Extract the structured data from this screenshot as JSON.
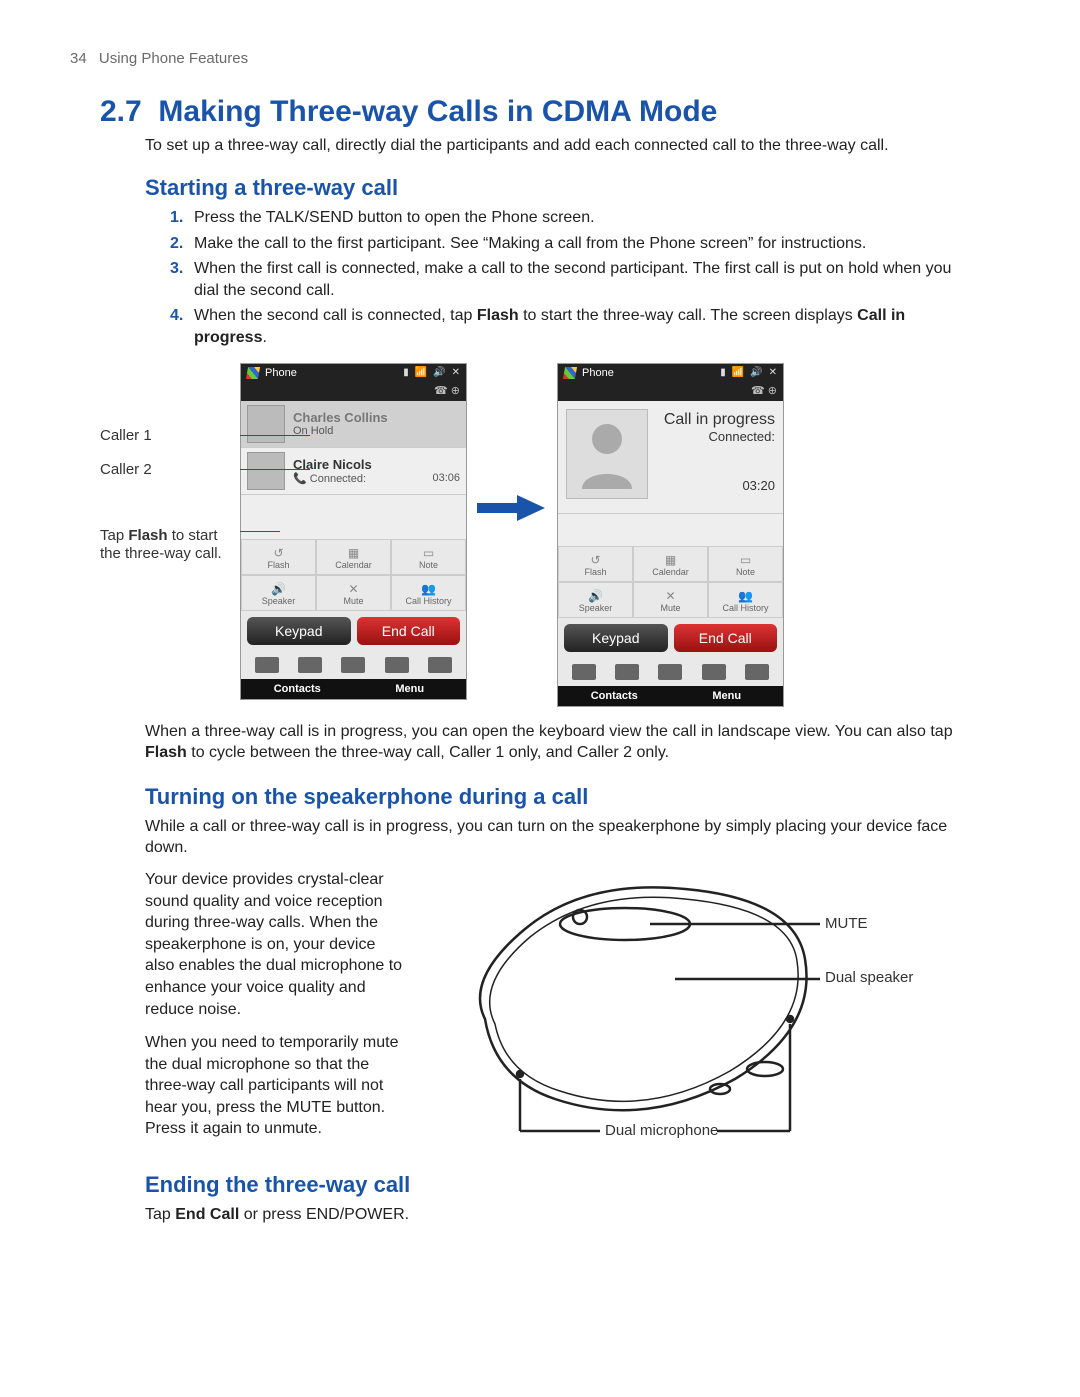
{
  "header": {
    "page_number": "34",
    "chapter": "Using Phone Features"
  },
  "section": {
    "number": "2.7",
    "title": "Making Three-way Calls in CDMA Mode",
    "intro": "To set up a three-way call, directly dial the participants and add each connected call to the three-way call."
  },
  "sub1": {
    "heading": "Starting a three-way call",
    "steps": [
      "Press the TALK/SEND button to open the Phone screen.",
      "Make the call to the first participant. See “Making a call from the Phone screen” for instructions.",
      "When the first call is connected, make a call to the second participant. The first call is put on hold when you dial the second call.",
      "When the second call is connected, tap "
    ],
    "step4_flash": "Flash",
    "step4_mid": " to start the three-way call. The screen displays ",
    "step4_cip": "Call in progress",
    "step4_end": "."
  },
  "annots": {
    "caller1": "Caller 1",
    "caller2": "Caller 2",
    "tapflash_pre": "Tap ",
    "tapflash_b": "Flash",
    "tapflash_post": " to start the three-way call."
  },
  "phoneA": {
    "title": "Phone",
    "c1_name": "Charles Collins",
    "c1_sub": "On Hold",
    "c2_name": "Claire Nicols",
    "c2_sub": "Connected:",
    "c2_time": "03:06",
    "btns": {
      "flash": "Flash",
      "calendar": "Calendar",
      "note": "Note",
      "speaker": "Speaker",
      "mute": "Mute",
      "history": "Call History"
    },
    "keypad": "Keypad",
    "endcall": "End Call",
    "foot_l": "Contacts",
    "foot_r": "Menu"
  },
  "phoneB": {
    "title": "Phone",
    "cip": "Call in progress",
    "conn": "Connected:",
    "time": "03:20",
    "btns": {
      "flash": "Flash",
      "calendar": "Calendar",
      "note": "Note",
      "speaker": "Speaker",
      "mute": "Mute",
      "history": "Call History"
    },
    "keypad": "Keypad",
    "endcall": "End Call",
    "foot_l": "Contacts",
    "foot_r": "Menu"
  },
  "after_fig": {
    "p_pre": "When a three-way call is in progress, you can open the keyboard view the call in landscape view. You can also tap ",
    "p_b": "Flash",
    "p_post": " to cycle between the three-way call, Caller 1 only, and Caller 2 only."
  },
  "sub2": {
    "heading": "Turning on the speakerphone during a call",
    "intro": "While a call or three-way call is in progress, you can turn on the speakerphone by simply placing your device face down.",
    "p2": "Your device provides crystal-clear sound quality and voice reception during three-way calls. When the speakerphone is on, your device also enables the dual microphone to enhance your voice quality and reduce noise.",
    "p3": "When you need to temporarily mute the dual microphone so that the three-way call participants will not hear you, press the MUTE button. Press it again to unmute."
  },
  "diagram_labels": {
    "mute": "MUTE",
    "speaker": "Dual speaker",
    "mic": "Dual microphone"
  },
  "sub3": {
    "heading": "Ending the three-way call",
    "p_pre": "Tap ",
    "p_b": "End Call",
    "p_post": " or press END/POWER."
  }
}
